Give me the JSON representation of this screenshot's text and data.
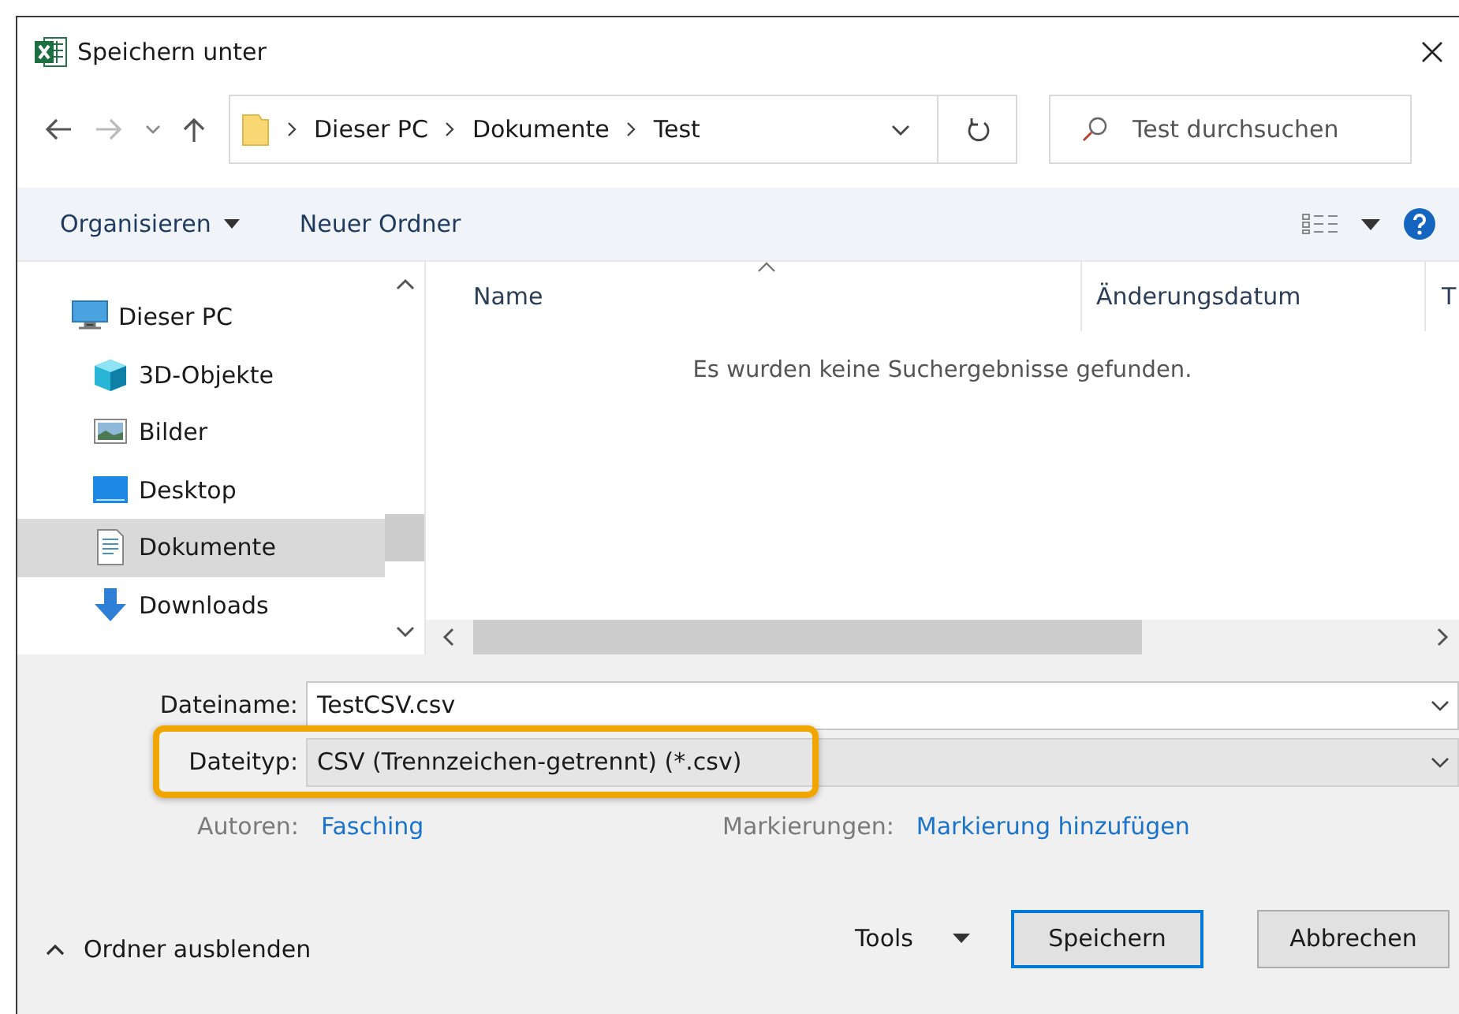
{
  "window": {
    "title": "Speichern unter"
  },
  "address": {
    "path": [
      "Dieser PC",
      "Dokumente",
      "Test"
    ]
  },
  "search": {
    "placeholder": "Test durchsuchen"
  },
  "toolbar": {
    "organize": "Organisieren",
    "new_folder": "Neuer Ordner"
  },
  "nav": {
    "items": [
      {
        "label": "Dieser PC",
        "kind": "pc",
        "selected": false
      },
      {
        "label": "3D-Objekte",
        "kind": "cube",
        "selected": false
      },
      {
        "label": "Bilder",
        "kind": "pictures",
        "selected": false
      },
      {
        "label": "Desktop",
        "kind": "desktop",
        "selected": false
      },
      {
        "label": "Dokumente",
        "kind": "documents",
        "selected": true
      },
      {
        "label": "Downloads",
        "kind": "downloads",
        "selected": false
      }
    ]
  },
  "table": {
    "columns": [
      "Name",
      "Änderungsdatum",
      "T"
    ],
    "empty_message": "Es wurden keine Suchergebnisse gefunden."
  },
  "filename": {
    "label": "Dateiname:",
    "value": "TestCSV.csv"
  },
  "filetype": {
    "label": "Dateityp:",
    "value": "CSV (Trennzeichen-getrennt) (*.csv)",
    "highlighted": true
  },
  "meta": [
    {
      "label": "Autoren:",
      "value": "Fasching"
    },
    {
      "label": "Markierungen:",
      "value": "Markierung hinzufügen"
    }
  ],
  "footer": {
    "hide_folders": "Ordner ausblenden",
    "tools": "Tools",
    "save": "Speichern",
    "cancel": "Abbrechen"
  }
}
